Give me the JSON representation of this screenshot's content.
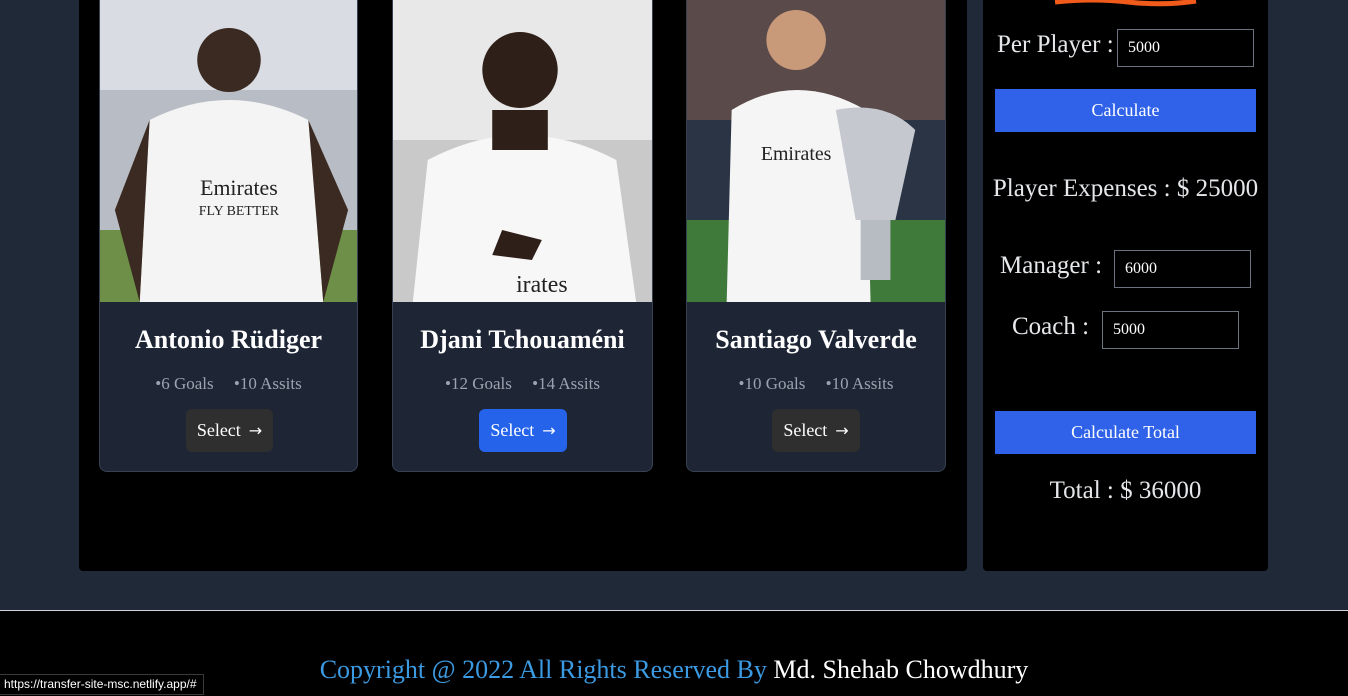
{
  "players": [
    {
      "name": "Antonio Rüdiger",
      "goals": "•6 Goals",
      "assists": "•10 Assits",
      "select_label": "Select",
      "selected": false
    },
    {
      "name": "Djani Tchouaméni",
      "goals": "•12 Goals",
      "assists": "•14 Assits",
      "select_label": "Select",
      "selected": true
    },
    {
      "name": "Santiago Valverde",
      "goals": "•10 Goals",
      "assists": "•10 Assits",
      "select_label": "Select",
      "selected": false
    }
  ],
  "calculator": {
    "per_player_label": "Per Player :",
    "per_player_value": "5000",
    "calculate_label": "Calculate",
    "player_expenses": "Player Expenses : $ 25000",
    "manager_label": "Manager :",
    "manager_value": "6000",
    "coach_label": "Coach :",
    "coach_value": "5000",
    "calculate_total_label": "Calculate Total",
    "total": "Total : $ 36000"
  },
  "footer": {
    "copyright": "Copyright @ 2022 All Rights Reserved By ",
    "author": "Md. Shehab Chowdhury"
  },
  "status_url": "https://transfer-site-msc.netlify.app/#",
  "colors": {
    "accent": "#2f62e8",
    "select_active": "#2563eb",
    "footer_link": "#3b9ae1"
  },
  "icons": {
    "select_arrow": "arrow-right-icon",
    "scribble": "orange-underline-scribble"
  }
}
